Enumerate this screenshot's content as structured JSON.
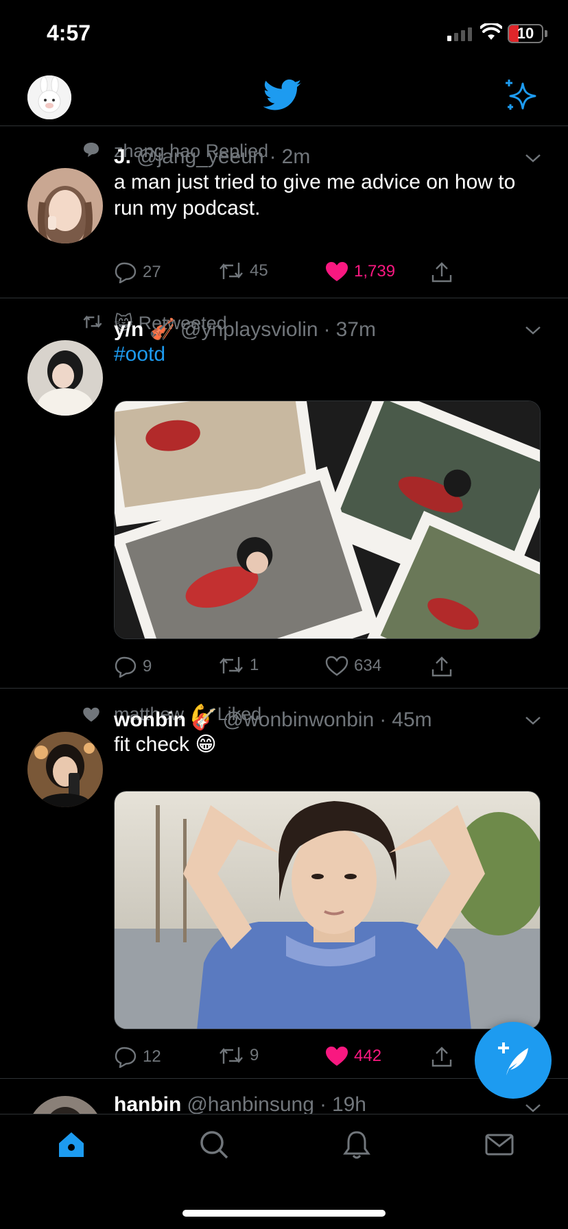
{
  "status_bar": {
    "time": "4:57",
    "battery": "10",
    "battery_level": 0.1
  },
  "colors": {
    "accent": "#1d9bf0",
    "like": "#f91880",
    "muted": "#71767b",
    "background": "#000000"
  },
  "top_nav": {
    "logo": "twitter-bird-icon",
    "right_icon": "sparkle-icon"
  },
  "tweets": [
    {
      "context": "zhang hao Replied",
      "name": "J.",
      "handle": "@jang_yeeun",
      "dot": "·",
      "time": "2m",
      "text": "a man just tried to give me advice on how to run my podcast.",
      "replies": "27",
      "retweets": "45",
      "likes": "1,739",
      "liked": true
    },
    {
      "context": "😸 Retweeted",
      "name": "y/n 🎻",
      "handle": "@ynplaysviolin",
      "dot": "·",
      "time": "37m",
      "text": "#ootd",
      "replies": "9",
      "retweets": "1",
      "likes": "634",
      "liked": false
    },
    {
      "context": "matthew 💪 Liked",
      "name": "wonbin 🎸",
      "handle": "@wonbinwonbin",
      "dot": "·",
      "time": "45m",
      "text": "fit check 😁",
      "replies": "12",
      "retweets": "9",
      "likes": "442",
      "liked": true
    },
    {
      "name": "hanbin",
      "handle": "@hanbinsung",
      "dot": "·",
      "time": "19h"
    }
  ],
  "bottom_nav": [
    "home-icon",
    "search-icon",
    "notifications-icon",
    "messages-icon"
  ]
}
